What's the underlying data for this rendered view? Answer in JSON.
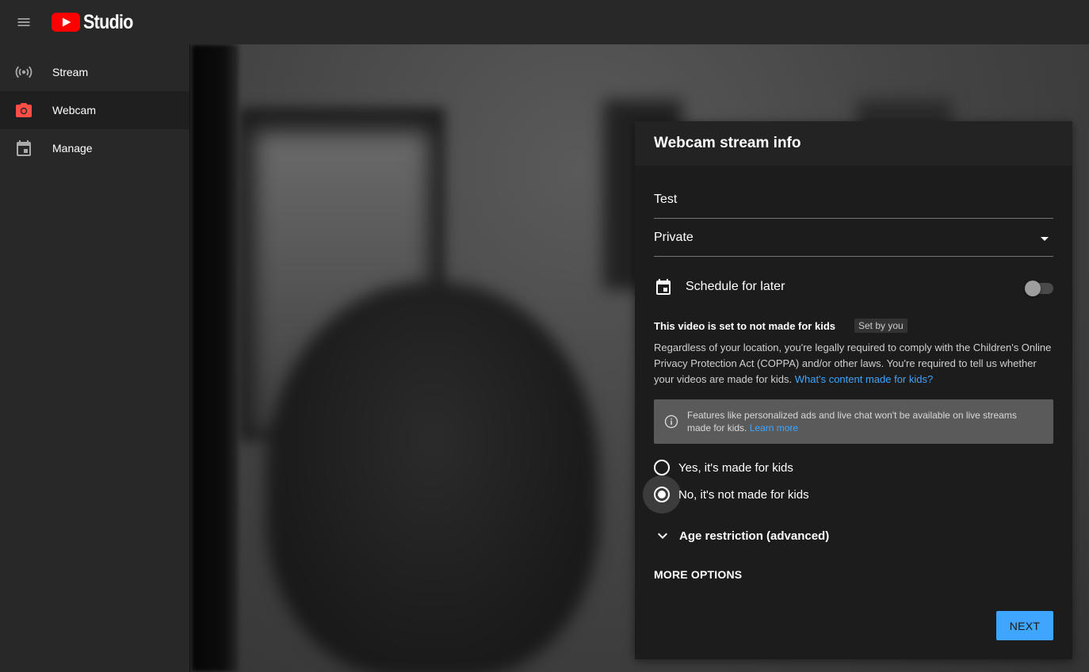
{
  "app": {
    "logo_text": "Studio",
    "brand_color": "#ff0000"
  },
  "sidebar": {
    "items": [
      {
        "label": "Stream",
        "icon": "stream-icon",
        "active": false
      },
      {
        "label": "Webcam",
        "icon": "camera-icon",
        "active": true
      },
      {
        "label": "Manage",
        "icon": "calendar-icon",
        "active": false
      }
    ]
  },
  "dialog": {
    "title": "Webcam stream info",
    "title_field_value": "Test",
    "visibility_value": "Private",
    "schedule_label": "Schedule for later",
    "schedule_enabled": false,
    "kids_title": "This video is set to not made for kids",
    "set_by_badge": "Set by you",
    "kids_description": "Regardless of your location, you're legally required to comply with the Children's Online Privacy Protection Act (COPPA) and/or other laws. You're required to tell us whether your videos are made for kids.",
    "kids_link": "What's content made for kids?",
    "info_text": "Features like personalized ads and live chat won't be available on live streams made for kids.",
    "info_link": "Learn more",
    "radio_yes": "Yes, it's made for kids",
    "radio_no": "No, it's not made for kids",
    "selected_option": "no",
    "age_restriction_label": "Age restriction (advanced)",
    "more_options_label": "MORE OPTIONS",
    "next_label": "NEXT"
  },
  "colors": {
    "accent": "#3ea6ff",
    "camera_icon": "#ff4e45"
  }
}
